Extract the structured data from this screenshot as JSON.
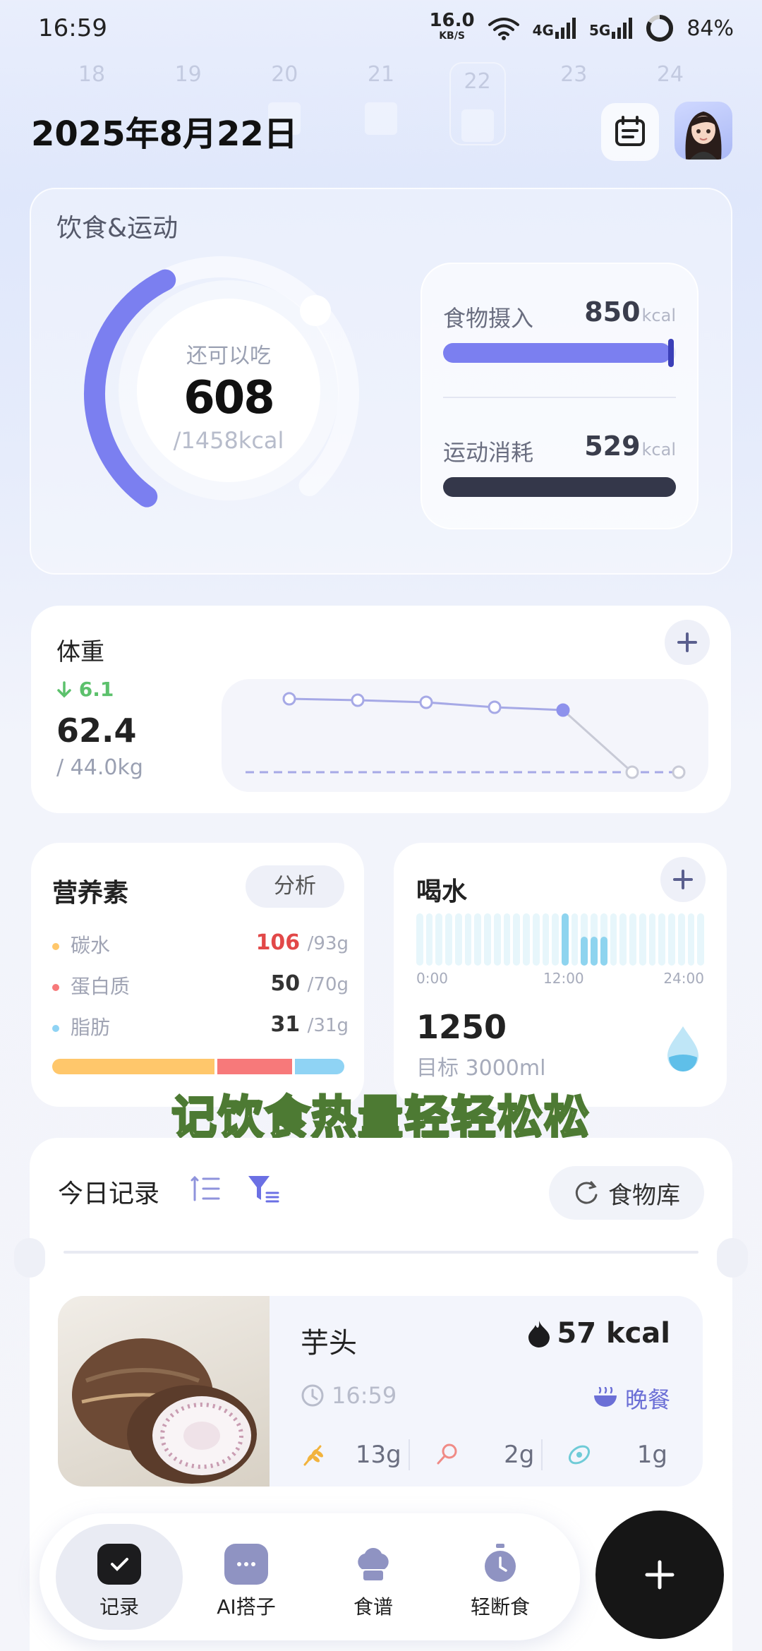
{
  "status_bar": {
    "time": "16:59",
    "net_speed": "16.0",
    "net_unit": "KB/S",
    "sig1": "4G",
    "sig2": "5G",
    "battery": "84%"
  },
  "week_strip": [
    "18",
    "19",
    "20",
    "21",
    "22",
    "23",
    "24"
  ],
  "header": {
    "date": "2025年8月22日"
  },
  "diet_card": {
    "title": "饮食&运动",
    "remaining_label": "还可以吃",
    "remaining_value": "608",
    "remaining_total": "/1458kcal",
    "intake_label": "食物摄入",
    "intake_value": "850",
    "exercise_label": "运动消耗",
    "exercise_value": "529",
    "unit": "kcal",
    "ring_progress": 0.42,
    "intake_progress": 0.98,
    "exercise_progress": 1.0,
    "accent": "#7b7ff0",
    "dark": "#34374a"
  },
  "weight_card": {
    "title": "体重",
    "delta": "6.1",
    "current": "62.4",
    "target": "/ 44.0kg"
  },
  "nutrients": {
    "title": "营养素",
    "analyze": "分析",
    "items": [
      {
        "name": "碳水",
        "value": "106",
        "target": "/93g",
        "color": "#ffc76b"
      },
      {
        "name": "蛋白质",
        "value": "50",
        "target": "/70g",
        "color": "#f7797a"
      },
      {
        "name": "脂肪",
        "value": "31",
        "target": "/31g",
        "color": "#8fd3f4"
      }
    ]
  },
  "water": {
    "title": "喝水",
    "axis_start": "0:00",
    "axis_mid": "12:00",
    "axis_end": "24:00",
    "amount": "1250",
    "goal": "目标 3000ml"
  },
  "slogan": "记饮食热量轻轻松松",
  "records": {
    "title": "今日记录",
    "food_library": "食物库",
    "item": {
      "name": "芋头",
      "kcal": "57 kcal",
      "time": "16:59",
      "meal": "晚餐",
      "carb": "13g",
      "protein": "2g",
      "fat": "1g"
    }
  },
  "nav": {
    "record": "记录",
    "ai": "AI搭子",
    "recipe": "食谱",
    "fasting": "轻断食"
  }
}
